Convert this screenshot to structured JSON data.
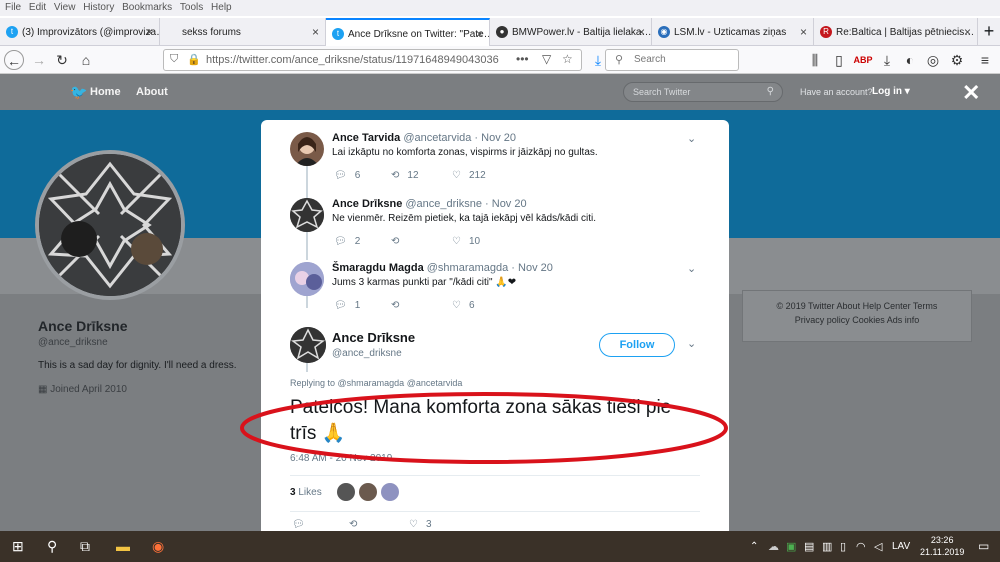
{
  "menu": [
    "File",
    "Edit",
    "View",
    "History",
    "Bookmarks",
    "Tools",
    "Help"
  ],
  "tabs": [
    {
      "label": "(3) Improvizātors (@improviza…",
      "icon": "twitter-icon"
    },
    {
      "label": "sekss forums",
      "icon": "page-icon"
    },
    {
      "label": "Ance Drīksne on Twitter: \"Pate…",
      "icon": "twitter-icon"
    },
    {
      "label": "BMWPower.lv - Baltija lielaka…",
      "icon": "bmw-icon"
    },
    {
      "label": "LSM.lv - Uzticamas ziņas",
      "icon": "location-icon"
    },
    {
      "label": "Re:Baltica | Baltijas pētniecis…",
      "icon": "rebaltica-icon"
    }
  ],
  "url": "https://twitter.com/ance_driksne/status/11971648949043036",
  "search_placeholder": "Search",
  "twitter_nav": {
    "home": "Home",
    "about": "About",
    "search_placeholder": "Search Twitter",
    "have_account": "Have an account?",
    "login": "Log in ▾"
  },
  "profile": {
    "name": "Ance Drīksne",
    "handle": "@ance_driksne",
    "bio": "This is a sad day for dignity. I'll need a dress.",
    "joined": "Joined April 2010"
  },
  "footer": {
    "line1": "© 2019 Twitter   About   Help Center   Terms",
    "line2": "Privacy policy   Cookies   Ads info"
  },
  "replies": [
    {
      "name": "Ance Tarvida",
      "handle": "@ancetarvida · Nov 20",
      "text": "Lai izkāptu no komforta zonas, vispirms ir jāizkāpj no gultas.",
      "replies": "6",
      "retweets": "12",
      "likes": "212"
    },
    {
      "name": "Ance Drīksne",
      "handle": "@ance_driksne · Nov 20",
      "text": "Ne vienmēr. Reizēm pietiek, ka tajā iekāpj vēl kāds/kādi citi.",
      "replies": "2",
      "retweets": "",
      "likes": "10"
    },
    {
      "name": "Šmaragdu Magda",
      "handle": "@shmaramagda · Nov 20",
      "text": "Jums 3 karmas punkti par \"/kādi citi\" 🙏❤",
      "replies": "1",
      "retweets": "",
      "likes": "6"
    }
  ],
  "main_tweet": {
    "name": "Ance Drīksne",
    "handle": "@ance_driksne",
    "follow": "Follow",
    "replying": "Replying to @shmaramagda @ancetarvida",
    "text_line1": "Pateicos! Mana komforta zona sākas tieši pie",
    "text_line2": "trīs 🙏",
    "time": "6:48 AM - 20 Nov 2019",
    "likes_count": "3",
    "likes_label": "Likes",
    "reply_count": "",
    "like_count_bottom": "3"
  },
  "taskbar": {
    "lang": "LAV",
    "time": "23:26",
    "date": "21.11.2019"
  },
  "colors": {
    "twitter_blue": "#1da1f2",
    "highlight_red": "#d9121b",
    "banner": "#0f6b9a"
  }
}
